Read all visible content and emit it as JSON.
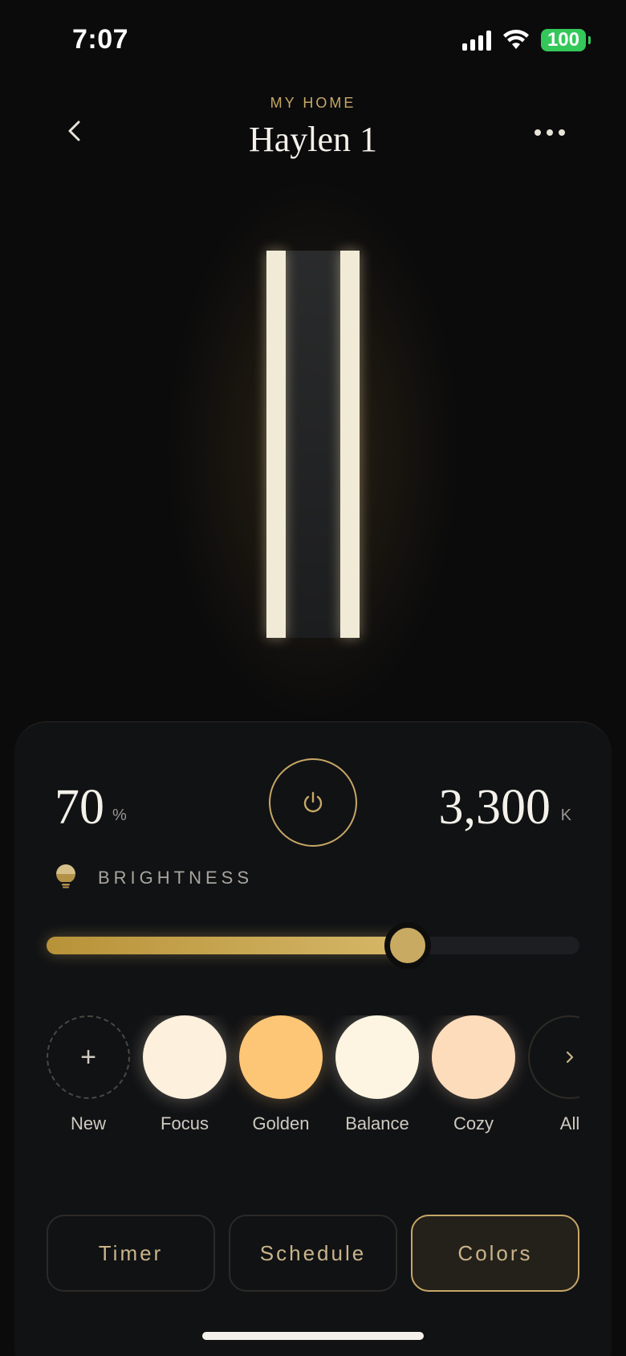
{
  "status_bar": {
    "time": "7:07",
    "battery": "100",
    "icons": [
      "cellular-signal-icon",
      "wifi-icon",
      "battery-icon"
    ]
  },
  "header": {
    "eyebrow": "MY HOME",
    "title": "Haylen 1",
    "back_icon": "chevron-left-icon",
    "more_icon": "ellipsis-icon"
  },
  "controls": {
    "brightness_value": "70",
    "brightness_unit": "%",
    "temperature_value": "3,300",
    "temperature_unit": "K",
    "brightness_label": "BRIGHTNESS",
    "brightness_level": 0.7,
    "power_icon": "power-icon",
    "bulb_icon": "bulb-icon"
  },
  "presets": [
    {
      "label": "New",
      "type": "add",
      "color": ""
    },
    {
      "label": "Focus",
      "type": "color",
      "color": "#fdf0dc"
    },
    {
      "label": "Golden",
      "type": "color",
      "color": "#fdc677"
    },
    {
      "label": "Balance",
      "type": "color",
      "color": "#fdf5e2"
    },
    {
      "label": "Cozy",
      "type": "color",
      "color": "#fddcbc"
    },
    {
      "label": "All",
      "type": "more",
      "color": ""
    }
  ],
  "tabs": [
    {
      "label": "Timer",
      "active": false
    },
    {
      "label": "Schedule",
      "active": false
    },
    {
      "label": "Colors",
      "active": true
    }
  ],
  "colors": {
    "accent": "#c6a766",
    "background": "#0b0b0c",
    "panel": "#111214"
  }
}
